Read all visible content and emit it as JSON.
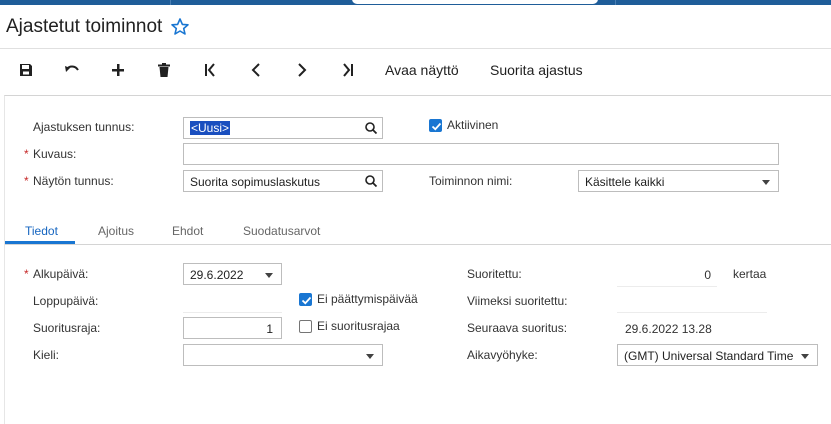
{
  "header": {
    "title": "Ajastetut toiminnot"
  },
  "toolbar": {
    "open_screen_label": "Avaa näyttö",
    "run_schedule_label": "Suorita ajastus"
  },
  "form": {
    "schedule_id_label": "Ajastuksen tunnus:",
    "schedule_id_value": "<Uusi>",
    "active_label": "Aktiivinen",
    "description_label": "Kuvaus:",
    "description_value": "",
    "screen_id_label": "Näytön tunnus:",
    "screen_id_value": "Suorita sopimuslaskutus",
    "action_name_label": "Toiminnon nimi:",
    "action_name_value": "Käsittele kaikki"
  },
  "tabs": [
    "Tiedot",
    "Ajoitus",
    "Ehdot",
    "Suodatusarvot"
  ],
  "details": {
    "start_date_label": "Alkupäivä:",
    "start_date_value": "29.6.2022",
    "end_date_label": "Loppupäivä:",
    "no_end_date_label": "Ei päättymispäivää",
    "run_limit_label": "Suoritusraja:",
    "run_limit_value": "1",
    "no_run_limit_label": "Ei suoritusrajaa",
    "language_label": "Kieli:",
    "language_value": "",
    "executed_label": "Suoritettu:",
    "executed_value": "0",
    "executed_unit": "kertaa",
    "last_run_label": "Viimeksi suoritettu:",
    "last_run_value": "",
    "next_run_label": "Seuraava suoritus:",
    "next_run_value": "29.6.2022 13.28",
    "timezone_label": "Aikavyöhyke:",
    "timezone_value": "(GMT) Universal Standard Time"
  },
  "colors": {
    "accent": "#1976d2",
    "required": "#c62828",
    "topbar": "#1f5d99"
  }
}
